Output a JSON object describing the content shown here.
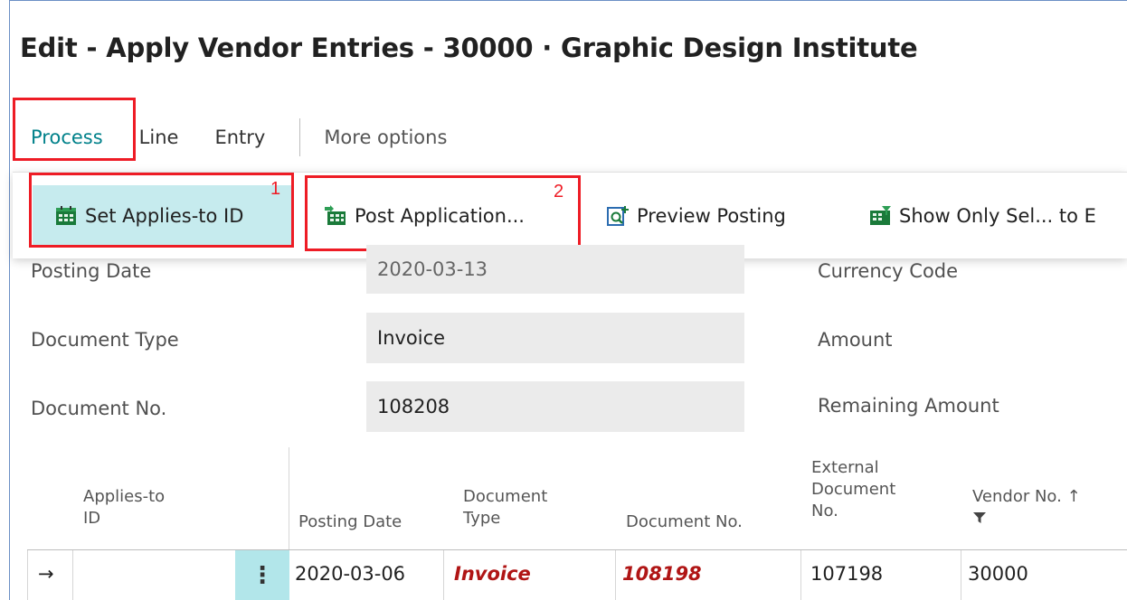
{
  "window": {
    "title": "Edit - Apply Vendor Entries - 30000 · Graphic Design Institute"
  },
  "menu": {
    "process": "Process",
    "line": "Line",
    "entry": "Entry",
    "more": "More options"
  },
  "actions": {
    "set_applies_to_id": "Set Applies-to ID",
    "post_application": "Post Application...",
    "preview_posting": "Preview Posting",
    "show_only_selected": "Show Only Sel... to E"
  },
  "annotations": {
    "one": "1",
    "two": "2"
  },
  "fields": {
    "posting_date": {
      "label": "Posting Date",
      "value": "2020-03-13"
    },
    "document_type": {
      "label": "Document Type",
      "value": "Invoice"
    },
    "document_no": {
      "label": "Document No.",
      "value": "108208"
    },
    "currency_code": {
      "label": "Currency Code"
    },
    "amount": {
      "label": "Amount"
    },
    "remaining_amount": {
      "label": "Remaining Amount"
    }
  },
  "grid": {
    "headers": {
      "applies_to_id": [
        "Applies-to",
        "ID"
      ],
      "posting_date": "Posting Date",
      "document_type": [
        "Document",
        "Type"
      ],
      "document_no": "Document No.",
      "external_doc_no": [
        "External",
        "Document",
        "No."
      ],
      "vendor_no": "Vendor No. ↑"
    },
    "rows": [
      {
        "indicator": "→",
        "applies_to_id": "",
        "posting_date": "2020-03-06",
        "document_type": "Invoice",
        "document_no": "108198",
        "external_doc_no": "107198",
        "vendor_no": "30000"
      }
    ]
  },
  "colors": {
    "accent": "#00818a",
    "highlight": "#ee1c25",
    "selected": "#c6ebee",
    "negative": "#b01515"
  }
}
